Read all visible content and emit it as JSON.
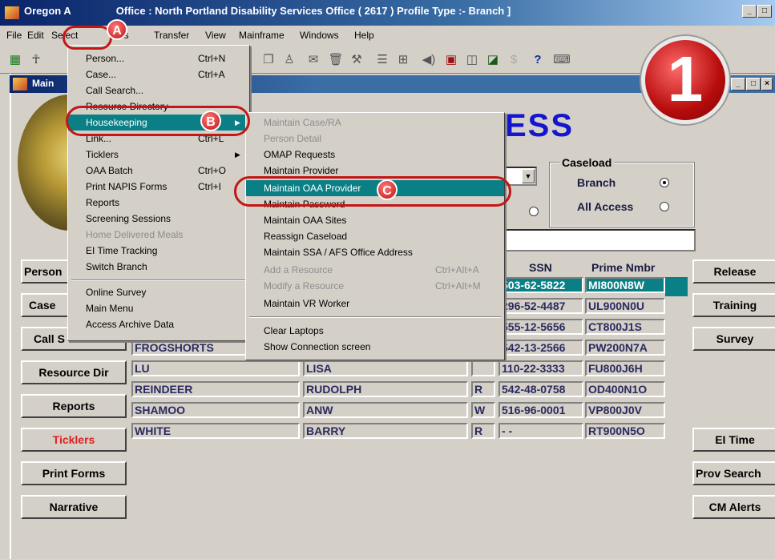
{
  "app": {
    "title": "Oregon Access: Office : North Portland Disability Services Office ( 2617 ) Profile Type :- Branch ]",
    "title_prefix": "Oregon A",
    "title_suffix": "Office : North Portland Disability Services Office ( 2617 ) Profile Type :- Branch ]",
    "window_controls": [
      "_",
      "□"
    ]
  },
  "menubar": [
    "File",
    "Edit",
    "Select",
    "Tools",
    "Transfer",
    "View",
    "Mainframe",
    "Windows",
    "Help"
  ],
  "inner_window": {
    "title": "Main",
    "controls": [
      "_",
      "□",
      "×"
    ]
  },
  "heading": "ESS",
  "caseload": {
    "title": "Caseload",
    "options": [
      {
        "label": "Branch",
        "selected": true
      },
      {
        "label": "All Access",
        "selected": false
      }
    ]
  },
  "select_menu": [
    {
      "label": "Person...",
      "shortcut": "Ctrl+N",
      "disabled": false
    },
    {
      "label": "Case...",
      "shortcut": "Ctrl+A",
      "disabled": false
    },
    {
      "label": "Call Search...",
      "shortcut": "",
      "disabled": false
    },
    {
      "label": "Resource Directory",
      "shortcut": "",
      "disabled": false
    },
    {
      "label": "Housekeeping",
      "shortcut": "▶",
      "disabled": false,
      "highlighted": true
    },
    {
      "label": "Link...",
      "shortcut": "Ctrl+L",
      "disabled": false
    },
    {
      "label": "Ticklers",
      "shortcut": "▶",
      "disabled": false
    },
    {
      "label": "OAA Batch",
      "shortcut": "Ctrl+O",
      "disabled": false
    },
    {
      "label": "Print NAPIS Forms",
      "shortcut": "Ctrl+I",
      "disabled": false
    },
    {
      "label": "Reports",
      "shortcut": "",
      "disabled": false
    },
    {
      "label": "Screening Sessions",
      "shortcut": "",
      "disabled": false
    },
    {
      "label": "Home Delivered Meals",
      "shortcut": "",
      "disabled": true
    },
    {
      "label": "EI Time Tracking",
      "shortcut": "",
      "disabled": false
    },
    {
      "label": "Switch Branch",
      "shortcut": "",
      "disabled": false
    },
    {
      "label": "Online Survey",
      "shortcut": "",
      "disabled": false
    },
    {
      "label": "Main Menu",
      "shortcut": "",
      "disabled": false
    },
    {
      "label": "Access Archive Data",
      "shortcut": "",
      "disabled": false
    }
  ],
  "housekeeping_menu": [
    {
      "label": "Maintain Case/RA",
      "shortcut": "",
      "disabled": true
    },
    {
      "label": "Person Detail",
      "shortcut": "",
      "disabled": true
    },
    {
      "label": "OMAP Requests",
      "shortcut": "",
      "disabled": false
    },
    {
      "label": "Maintain Provider",
      "shortcut": "",
      "disabled": false
    },
    {
      "label": "Maintain OAA Provider",
      "shortcut": "",
      "disabled": false,
      "highlighted": true
    },
    {
      "label": "Maintain Password",
      "shortcut": "",
      "disabled": false
    },
    {
      "label": "Maintain OAA Sites",
      "shortcut": "",
      "disabled": false
    },
    {
      "label": "Reassign Caseload",
      "shortcut": "",
      "disabled": false
    },
    {
      "label": "Maintain SSA / AFS Office Address",
      "shortcut": "",
      "disabled": false
    },
    {
      "label": "Add a Resource",
      "shortcut": "Ctrl+Alt+A",
      "disabled": true
    },
    {
      "label": "Modify a Resource",
      "shortcut": "Ctrl+Alt+M",
      "disabled": true
    },
    {
      "label": "Maintain VR Worker",
      "shortcut": "",
      "disabled": false
    },
    {
      "label": "Clear Laptops",
      "shortcut": "",
      "disabled": false
    },
    {
      "label": "Show Connection screen",
      "shortcut": "",
      "disabled": false
    }
  ],
  "left_buttons": [
    "Person",
    "Case",
    "Call S",
    "Resource Dir",
    "Reports",
    "Ticklers",
    "Print Forms",
    "Narrative"
  ],
  "right_buttons": [
    "Release",
    "Training",
    "Survey",
    "EI Time",
    "Prov Search",
    "CM Alerts"
  ],
  "grid": {
    "headers": [
      "SSN",
      "Prime Nmbr"
    ],
    "rows": [
      {
        "last": "",
        "first": "",
        "flag": "",
        "ssn": "503-62-5822",
        "prime": "MI800N8W"
      },
      {
        "last": "",
        "first": "",
        "flag": "",
        "ssn": "296-52-4487",
        "prime": "UL900N0U"
      },
      {
        "last": "",
        "first": "",
        "flag": "",
        "ssn": "555-12-5656",
        "prime": "CT800J1S"
      },
      {
        "last": "FROGSHORTS",
        "first": "",
        "flag": "",
        "ssn": "542-13-2566",
        "prime": "PW200N7A"
      },
      {
        "last": "LU",
        "first": "LISA",
        "flag": "",
        "ssn": "110-22-3333",
        "prime": "FU800J6H"
      },
      {
        "last": "REINDEER",
        "first": "RUDOLPH",
        "flag": "R",
        "ssn": "542-48-0758",
        "prime": "OD400N1O"
      },
      {
        "last": "SHAMOO",
        "first": "ANW",
        "flag": "W",
        "ssn": "516-96-0001",
        "prime": "VP800J0V"
      },
      {
        "last": "WHITE",
        "first": "BARRY",
        "flag": "R",
        "ssn": "- -",
        "prime": "RT900N5O"
      }
    ]
  },
  "annotations": {
    "a": "A",
    "b": "B",
    "c": "C",
    "step": "1"
  },
  "colors": {
    "highlight": "#0a7f86",
    "ticklers": "#e02020",
    "heading": "#1515d0",
    "annotation": "#c41616"
  }
}
